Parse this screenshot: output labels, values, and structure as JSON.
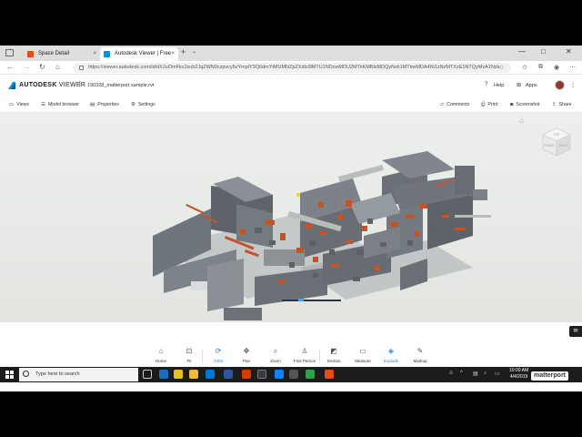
{
  "browser": {
    "tabs": [
      {
        "title": "Space Detail",
        "active": false
      },
      {
        "title": "Autodesk Viewer | Free",
        "active": true
      }
    ],
    "new_tab_symbol": "+",
    "tab_menu_symbol": "⌄",
    "close_symbol": "×",
    "window_controls": [
      "—",
      "□",
      "✕"
    ],
    "url": "https://viewer.autodesk.com/id/dXJuOmFkc2sub2JqZWN0czpvcy5vYmplY3Q6dmYtMUMNZpZXdlcl9MTU1NDcwMDU2MTkKMBlxMDQyNzk1MTkwMDA4Ni1zNzMTXzE1NTQyMzA1Nzk"
  },
  "app": {
    "brand_bold": "AUTODESK",
    "brand_light": "VIEWER",
    "crumb_sep": "|",
    "file_name": "190328_matterport sample.rvt",
    "help_label": "Help",
    "apps_label": "Apps"
  },
  "toolbar": {
    "views": "Views",
    "model_browser": "Model browser",
    "properties": "Properties",
    "settings": "Settings",
    "comments": "Comments",
    "print": "Print",
    "screenshot": "Screenshot",
    "share": "Share"
  },
  "viewcube": {
    "top": "TOP",
    "front": "FRONT",
    "right": "RIGHT"
  },
  "viewer_tools": [
    {
      "label": "Home",
      "icon": "⌂",
      "active": false
    },
    {
      "label": "Fit",
      "icon": "⊡",
      "active": false
    },
    {
      "label": "Orbit",
      "icon": "⟳",
      "active": true
    },
    {
      "label": "Pan",
      "icon": "✥",
      "active": false
    },
    {
      "label": "Zoom",
      "icon": "⌕",
      "active": false
    },
    {
      "label": "First Person",
      "icon": "♙",
      "active": false
    },
    {
      "label": "Section",
      "icon": "◩",
      "active": false
    },
    {
      "label": "Measure",
      "icon": "▭",
      "active": false
    },
    {
      "label": "Explode",
      "icon": "◈",
      "active": true
    },
    {
      "label": "Markup",
      "icon": "✎",
      "active": false
    }
  ],
  "taskbar": {
    "search_placeholder": "Type here to search",
    "time": "10:00 AM",
    "date": "4/4/2019",
    "watermark": "matterport"
  },
  "colors": {
    "accent": "#1e88e5",
    "steel": "#6f757c",
    "pipe": "#c0552c",
    "taskbar": "#1c1c1c"
  }
}
